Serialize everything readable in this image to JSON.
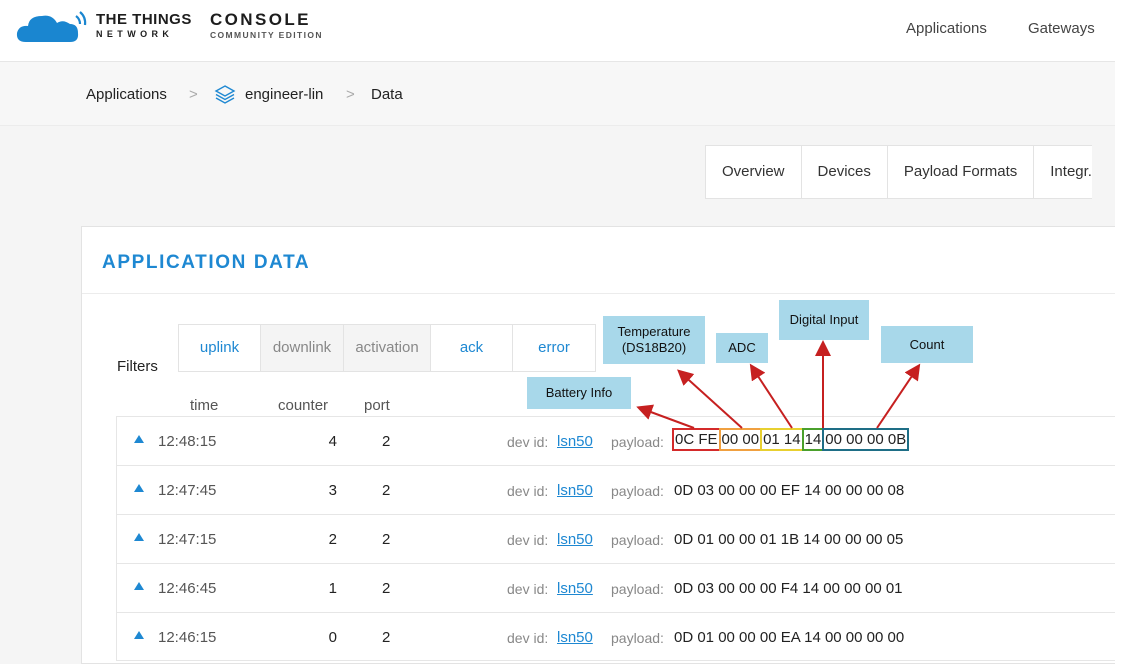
{
  "header": {
    "brand_line1": "THE THINGS",
    "brand_line2": "NETWORK",
    "console_line1": "CONSOLE",
    "console_line2": "COMMUNITY EDITION",
    "nav": [
      "Applications",
      "Gateways"
    ]
  },
  "breadcrumb": {
    "applications": "Applications",
    "separator": ">",
    "application_id": "engineer-lin",
    "current": "Data"
  },
  "tabs": [
    "Overview",
    "Devices",
    "Payload Formats",
    "Integr."
  ],
  "card": {
    "title": "APPLICATION DATA"
  },
  "filters": {
    "label": "Filters",
    "buttons": [
      "uplink",
      "downlink",
      "activation",
      "ack",
      "error"
    ]
  },
  "columns": {
    "time": "time",
    "counter": "counter",
    "port": "port"
  },
  "row_labels": {
    "dev_id": "dev id:",
    "payload": "payload:"
  },
  "rows": [
    {
      "time": "12:48:15",
      "counter": "4",
      "port": "2",
      "dev_id": "lsn50",
      "payload": "0C FE 00 00 01 14 14 00 00 00 0B"
    },
    {
      "time": "12:47:45",
      "counter": "3",
      "port": "2",
      "dev_id": "lsn50",
      "payload": "0D 03 00 00 00 EF 14 00 00 00 08"
    },
    {
      "time": "12:47:15",
      "counter": "2",
      "port": "2",
      "dev_id": "lsn50",
      "payload": "0D 01 00 00 01 1B 14 00 00 00 05"
    },
    {
      "time": "12:46:45",
      "counter": "1",
      "port": "2",
      "dev_id": "lsn50",
      "payload": "0D 03 00 00 00 F4 14 00 00 00 01"
    },
    {
      "time": "12:46:15",
      "counter": "0",
      "port": "2",
      "dev_id": "lsn50",
      "payload": "0D 01 00 00 00 EA 14 00 00 00 00"
    }
  ],
  "payload_segments": [
    "0C FE",
    "00 00",
    "01 14",
    "14",
    "00 00 00 0B"
  ],
  "annotations": {
    "temperature": "Temperature (DS18B20)",
    "adc": "ADC",
    "digital_input": "Digital Input",
    "count": "Count",
    "battery": "Battery Info"
  },
  "colors": {
    "accent": "#1e88d2",
    "annotation_bg": "#a8d8ea",
    "arrow": "#c62020",
    "seg_battery": "#d42a2a",
    "seg_temperature": "#f0a040",
    "seg_adc": "#e8d030",
    "seg_digital": "#4aa02c",
    "seg_count": "#1e6e86"
  }
}
